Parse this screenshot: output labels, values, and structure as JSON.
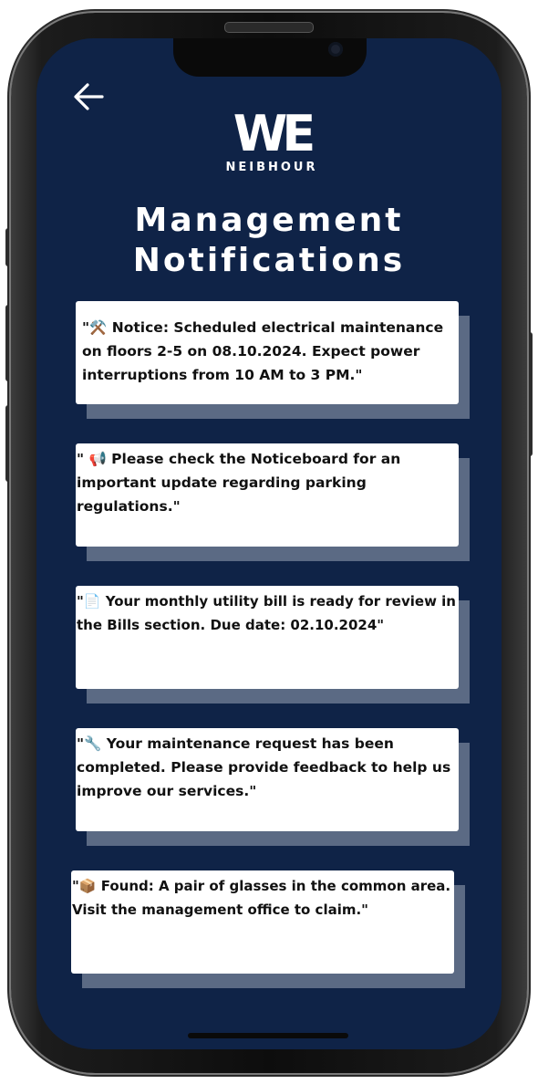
{
  "app": {
    "logo_mark": "WE",
    "logo_text": "NEIBHOUR"
  },
  "header": {
    "title_line1": "Management",
    "title_line2": "Notifications"
  },
  "notifications": [
    {
      "text": "\"⚒️ Notice: Scheduled electrical maintenance on floors 2-5 on 08.10.2024. Expect power interruptions from 10 AM to 3 PM.\""
    },
    {
      "text": "\" 📢 Please check the Noticeboard for an important update regarding parking regulations.\""
    },
    {
      "text": "\"📄 Your monthly utility bill is ready for review in the Bills section. Due date: 02.10.2024\""
    },
    {
      "text": "\"🔧 Your maintenance request has been completed. Please provide feedback to help us improve our services.\""
    },
    {
      "text": "\"📦 Found: A pair of glasses in the common area. Visit the management office to claim.\""
    }
  ],
  "colors": {
    "background": "#0f2347",
    "card": "#ffffff",
    "card_shadow": "#5b6a84"
  },
  "icons": {
    "back": "arrow-left-icon"
  }
}
